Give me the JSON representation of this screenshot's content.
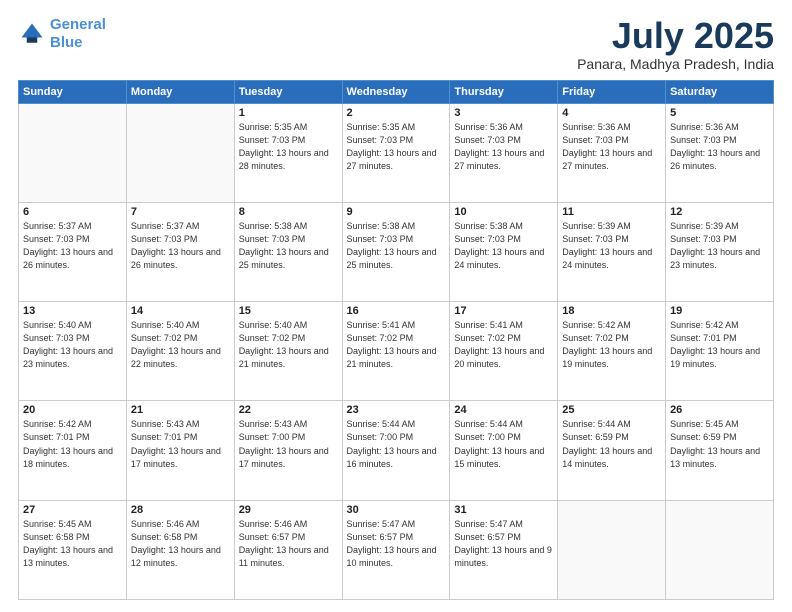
{
  "logo": {
    "line1": "General",
    "line2": "Blue"
  },
  "title": "July 2025",
  "location": "Panara, Madhya Pradesh, India",
  "weekdays": [
    "Sunday",
    "Monday",
    "Tuesday",
    "Wednesday",
    "Thursday",
    "Friday",
    "Saturday"
  ],
  "weeks": [
    [
      {
        "day": "",
        "sunrise": "",
        "sunset": "",
        "daylight": ""
      },
      {
        "day": "",
        "sunrise": "",
        "sunset": "",
        "daylight": ""
      },
      {
        "day": "1",
        "sunrise": "Sunrise: 5:35 AM",
        "sunset": "Sunset: 7:03 PM",
        "daylight": "Daylight: 13 hours and 28 minutes."
      },
      {
        "day": "2",
        "sunrise": "Sunrise: 5:35 AM",
        "sunset": "Sunset: 7:03 PM",
        "daylight": "Daylight: 13 hours and 27 minutes."
      },
      {
        "day": "3",
        "sunrise": "Sunrise: 5:36 AM",
        "sunset": "Sunset: 7:03 PM",
        "daylight": "Daylight: 13 hours and 27 minutes."
      },
      {
        "day": "4",
        "sunrise": "Sunrise: 5:36 AM",
        "sunset": "Sunset: 7:03 PM",
        "daylight": "Daylight: 13 hours and 27 minutes."
      },
      {
        "day": "5",
        "sunrise": "Sunrise: 5:36 AM",
        "sunset": "Sunset: 7:03 PM",
        "daylight": "Daylight: 13 hours and 26 minutes."
      }
    ],
    [
      {
        "day": "6",
        "sunrise": "Sunrise: 5:37 AM",
        "sunset": "Sunset: 7:03 PM",
        "daylight": "Daylight: 13 hours and 26 minutes."
      },
      {
        "day": "7",
        "sunrise": "Sunrise: 5:37 AM",
        "sunset": "Sunset: 7:03 PM",
        "daylight": "Daylight: 13 hours and 26 minutes."
      },
      {
        "day": "8",
        "sunrise": "Sunrise: 5:38 AM",
        "sunset": "Sunset: 7:03 PM",
        "daylight": "Daylight: 13 hours and 25 minutes."
      },
      {
        "day": "9",
        "sunrise": "Sunrise: 5:38 AM",
        "sunset": "Sunset: 7:03 PM",
        "daylight": "Daylight: 13 hours and 25 minutes."
      },
      {
        "day": "10",
        "sunrise": "Sunrise: 5:38 AM",
        "sunset": "Sunset: 7:03 PM",
        "daylight": "Daylight: 13 hours and 24 minutes."
      },
      {
        "day": "11",
        "sunrise": "Sunrise: 5:39 AM",
        "sunset": "Sunset: 7:03 PM",
        "daylight": "Daylight: 13 hours and 24 minutes."
      },
      {
        "day": "12",
        "sunrise": "Sunrise: 5:39 AM",
        "sunset": "Sunset: 7:03 PM",
        "daylight": "Daylight: 13 hours and 23 minutes."
      }
    ],
    [
      {
        "day": "13",
        "sunrise": "Sunrise: 5:40 AM",
        "sunset": "Sunset: 7:03 PM",
        "daylight": "Daylight: 13 hours and 23 minutes."
      },
      {
        "day": "14",
        "sunrise": "Sunrise: 5:40 AM",
        "sunset": "Sunset: 7:02 PM",
        "daylight": "Daylight: 13 hours and 22 minutes."
      },
      {
        "day": "15",
        "sunrise": "Sunrise: 5:40 AM",
        "sunset": "Sunset: 7:02 PM",
        "daylight": "Daylight: 13 hours and 21 minutes."
      },
      {
        "day": "16",
        "sunrise": "Sunrise: 5:41 AM",
        "sunset": "Sunset: 7:02 PM",
        "daylight": "Daylight: 13 hours and 21 minutes."
      },
      {
        "day": "17",
        "sunrise": "Sunrise: 5:41 AM",
        "sunset": "Sunset: 7:02 PM",
        "daylight": "Daylight: 13 hours and 20 minutes."
      },
      {
        "day": "18",
        "sunrise": "Sunrise: 5:42 AM",
        "sunset": "Sunset: 7:02 PM",
        "daylight": "Daylight: 13 hours and 19 minutes."
      },
      {
        "day": "19",
        "sunrise": "Sunrise: 5:42 AM",
        "sunset": "Sunset: 7:01 PM",
        "daylight": "Daylight: 13 hours and 19 minutes."
      }
    ],
    [
      {
        "day": "20",
        "sunrise": "Sunrise: 5:42 AM",
        "sunset": "Sunset: 7:01 PM",
        "daylight": "Daylight: 13 hours and 18 minutes."
      },
      {
        "day": "21",
        "sunrise": "Sunrise: 5:43 AM",
        "sunset": "Sunset: 7:01 PM",
        "daylight": "Daylight: 13 hours and 17 minutes."
      },
      {
        "day": "22",
        "sunrise": "Sunrise: 5:43 AM",
        "sunset": "Sunset: 7:00 PM",
        "daylight": "Daylight: 13 hours and 17 minutes."
      },
      {
        "day": "23",
        "sunrise": "Sunrise: 5:44 AM",
        "sunset": "Sunset: 7:00 PM",
        "daylight": "Daylight: 13 hours and 16 minutes."
      },
      {
        "day": "24",
        "sunrise": "Sunrise: 5:44 AM",
        "sunset": "Sunset: 7:00 PM",
        "daylight": "Daylight: 13 hours and 15 minutes."
      },
      {
        "day": "25",
        "sunrise": "Sunrise: 5:44 AM",
        "sunset": "Sunset: 6:59 PM",
        "daylight": "Daylight: 13 hours and 14 minutes."
      },
      {
        "day": "26",
        "sunrise": "Sunrise: 5:45 AM",
        "sunset": "Sunset: 6:59 PM",
        "daylight": "Daylight: 13 hours and 13 minutes."
      }
    ],
    [
      {
        "day": "27",
        "sunrise": "Sunrise: 5:45 AM",
        "sunset": "Sunset: 6:58 PM",
        "daylight": "Daylight: 13 hours and 13 minutes."
      },
      {
        "day": "28",
        "sunrise": "Sunrise: 5:46 AM",
        "sunset": "Sunset: 6:58 PM",
        "daylight": "Daylight: 13 hours and 12 minutes."
      },
      {
        "day": "29",
        "sunrise": "Sunrise: 5:46 AM",
        "sunset": "Sunset: 6:57 PM",
        "daylight": "Daylight: 13 hours and 11 minutes."
      },
      {
        "day": "30",
        "sunrise": "Sunrise: 5:47 AM",
        "sunset": "Sunset: 6:57 PM",
        "daylight": "Daylight: 13 hours and 10 minutes."
      },
      {
        "day": "31",
        "sunrise": "Sunrise: 5:47 AM",
        "sunset": "Sunset: 6:57 PM",
        "daylight": "Daylight: 13 hours and 9 minutes."
      },
      {
        "day": "",
        "sunrise": "",
        "sunset": "",
        "daylight": ""
      },
      {
        "day": "",
        "sunrise": "",
        "sunset": "",
        "daylight": ""
      }
    ]
  ]
}
